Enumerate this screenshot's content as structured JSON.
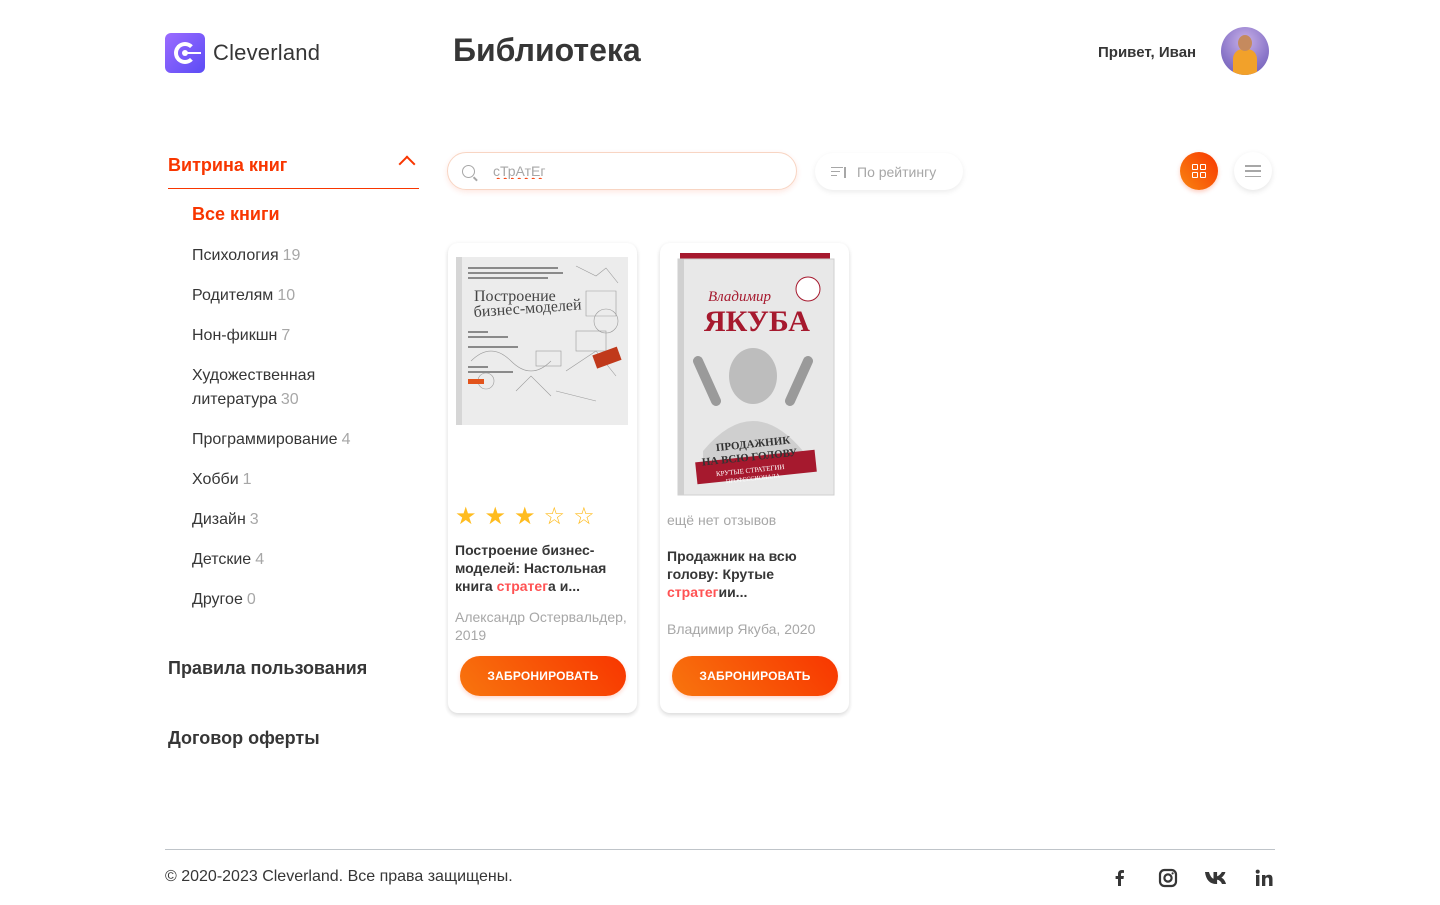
{
  "brand": {
    "name": "Cleverland"
  },
  "header": {
    "title": "Библиотека",
    "greeting": "Привет, Иван"
  },
  "sidebar": {
    "section_title": "Витрина книг",
    "all_books": "Все книги",
    "categories": [
      {
        "label": "Психология",
        "count": "19"
      },
      {
        "label": "Родителям",
        "count": "10"
      },
      {
        "label": "Нон-фикшн",
        "count": "7"
      },
      {
        "label": "Художественная литература",
        "count": "30"
      },
      {
        "label": "Программирование",
        "count": "4"
      },
      {
        "label": "Хобби",
        "count": "1"
      },
      {
        "label": "Дизайн",
        "count": "3"
      },
      {
        "label": "Детские",
        "count": "4"
      },
      {
        "label": "Другое",
        "count": "0"
      }
    ],
    "rules": "Правила пользования",
    "offer": "Договор оферты"
  },
  "toolbar": {
    "search_value": "сТрАтЕг",
    "sort_label": "По рейтингу"
  },
  "books": [
    {
      "rating": 3,
      "rating_max": 5,
      "title_before": "Построение бизнес-моделей: Настольная книга ",
      "title_highlight": "стратег",
      "title_after": "а и...",
      "author": "Александр Остервальдер, 2019",
      "button": "ЗАБРОНИРОВАТЬ",
      "cover": {
        "line1": "Построение",
        "line2": "бизнес-моделей"
      }
    },
    {
      "no_reviews": "ещё нет отзывов",
      "title_before": "Продажник на всю голову: Крутые ",
      "title_highlight": "стратег",
      "title_after": "ии...",
      "author": "Владимир Якуба, 2020",
      "button": "ЗАБРОНИРОВАТЬ",
      "cover": {
        "line1": "Владимир",
        "line2": "ЯКУБА",
        "line3": "ПРОДАЖНИК",
        "line4": "НА ВСЮ ГОЛОВУ",
        "line5": "КРУТЫЕ СТРАТЕГИИ",
        "line6": "ПРОФЕССИОНАЛА"
      }
    }
  ],
  "footer": {
    "copyright": "© 2020-2023 Cleverland. Все права защищены."
  },
  "colors": {
    "accent": "#f83600",
    "highlight": "#ff5253",
    "star": "#ffbc1f",
    "muted": "#a7a7a7",
    "text": "#363636"
  },
  "icons": [
    "facebook-icon",
    "instagram-icon",
    "vk-icon",
    "linkedin-icon"
  ]
}
